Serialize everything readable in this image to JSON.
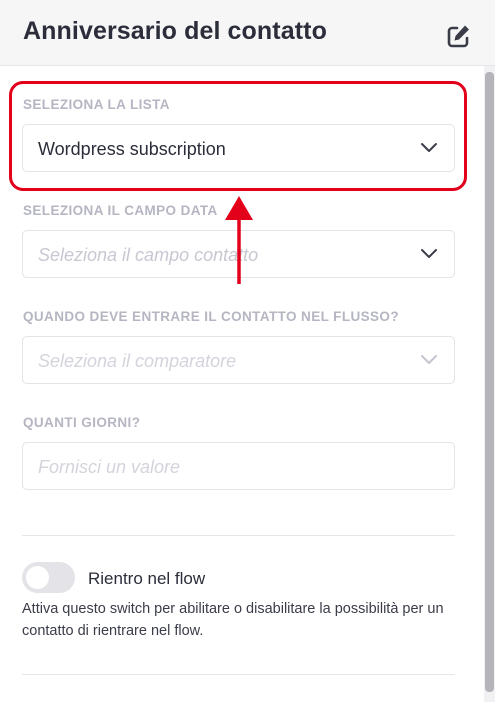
{
  "header": {
    "title": "Anniversario del contatto",
    "edit_icon": "edit-icon"
  },
  "fields": {
    "list": {
      "label": "SELEZIONA LA LISTA",
      "value": "Wordpress subscription"
    },
    "date_field": {
      "label": "SELEZIONA IL CAMPO DATA",
      "placeholder": "Seleziona il campo contatto"
    },
    "entry_when": {
      "label": "QUANDO DEVE ENTRARE IL CONTATTO NEL FLUSSO?",
      "placeholder": "Seleziona il comparatore"
    },
    "days": {
      "label": "QUANTI GIORNI?",
      "placeholder": "Fornisci un valore"
    }
  },
  "reentry": {
    "label": "Rientro nel flow",
    "enabled": false,
    "helper": "Attiva questo switch per abilitare o disabilitare la possibilità per un contatto di rientrare nel flow."
  },
  "colors": {
    "annotation": "#e3001b",
    "text": "#2b2d3a",
    "label": "#b5b6c2",
    "placeholder": "#c7c8d2",
    "border": "#e3e3e8",
    "toggle_off": "#e4e4e8"
  }
}
